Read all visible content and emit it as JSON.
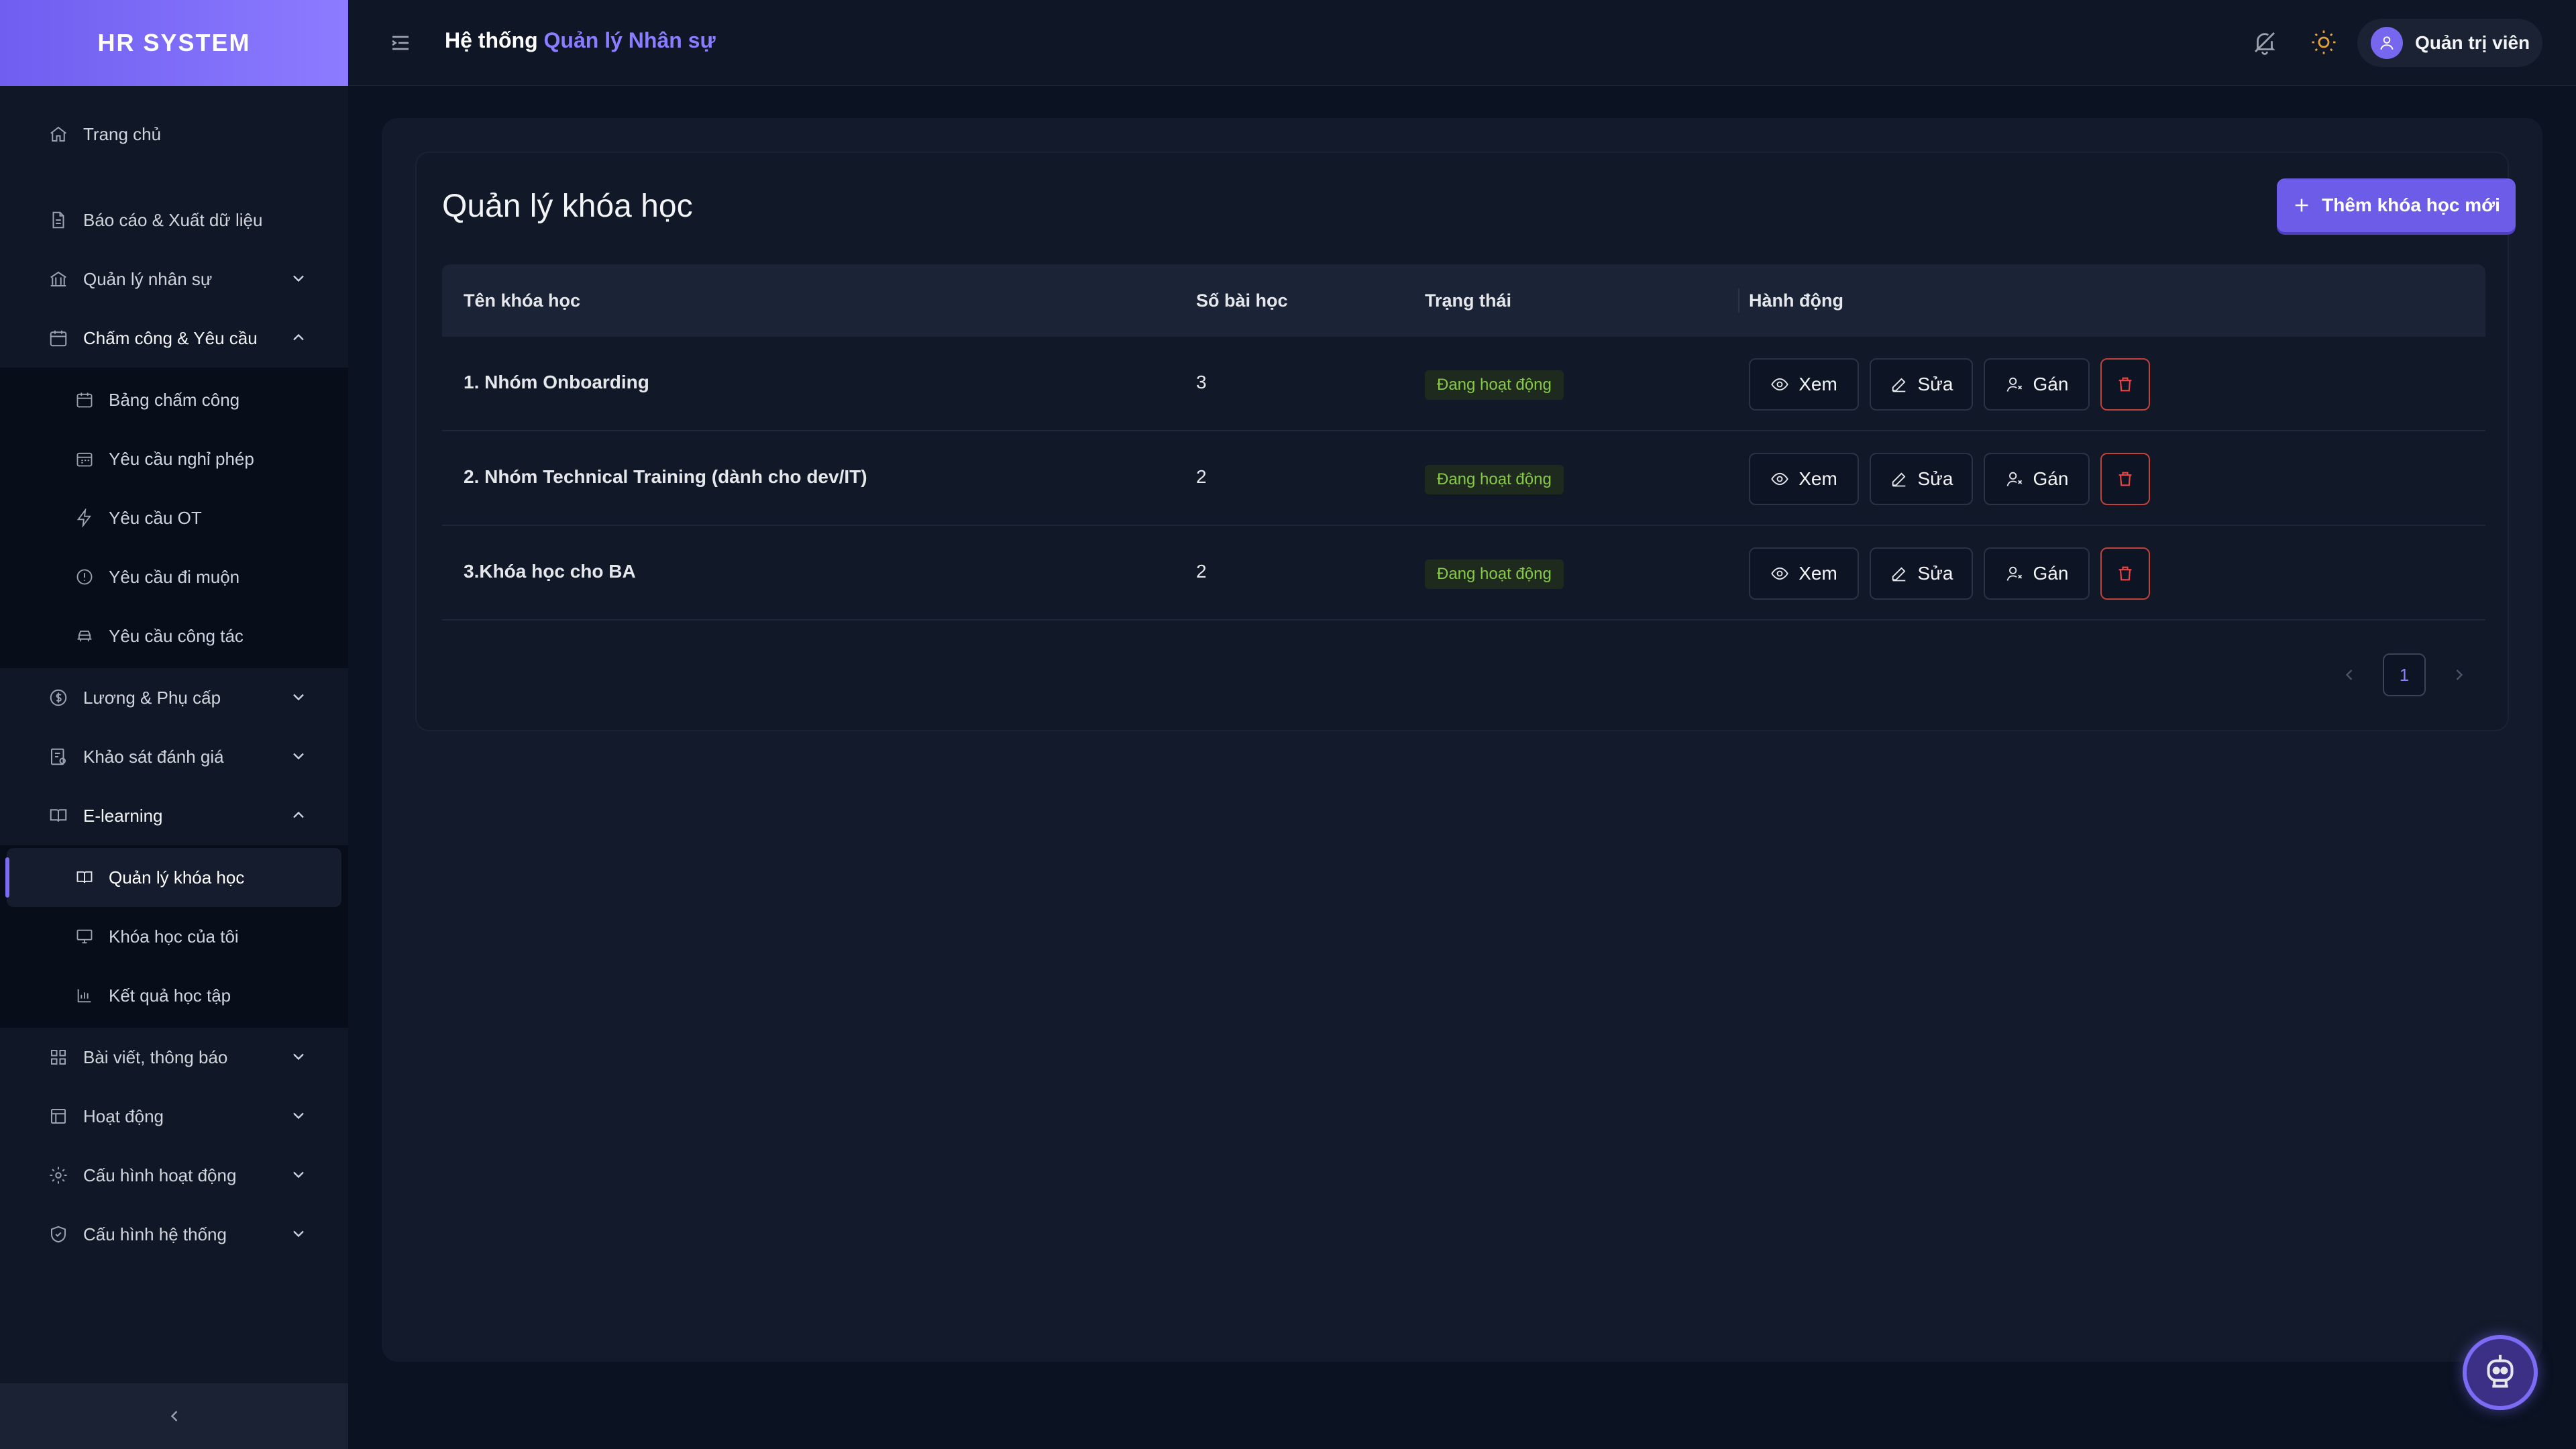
{
  "brand": "HR SYSTEM",
  "header": {
    "title_prefix": "Hệ thống",
    "title_accent": "Quản lý Nhân sự",
    "user_name": "Quản trị viên"
  },
  "sidebar": {
    "items": [
      {
        "label": "Trang chủ",
        "icon": "home-icon"
      },
      {
        "label": "Báo cáo & Xuất dữ liệu",
        "icon": "file-report-icon"
      },
      {
        "label": "Quản lý nhân sự",
        "icon": "building-icon"
      },
      {
        "label": "Chấm công & Yêu cầu",
        "icon": "calendar-icon"
      },
      {
        "label": "Lương & Phụ cấp",
        "icon": "dollar-circle-icon"
      },
      {
        "label": "Khảo sát đánh giá",
        "icon": "survey-icon"
      },
      {
        "label": "E-learning",
        "icon": "book-open-icon"
      },
      {
        "label": "Bài viết, thông báo",
        "icon": "grid-icon"
      },
      {
        "label": "Hoạt động",
        "icon": "activity-icon"
      },
      {
        "label": "Cấu hình hoạt động",
        "icon": "gear-icon"
      },
      {
        "label": "Cấu hình hệ thống",
        "icon": "shield-icon"
      }
    ],
    "attendance_sub": [
      {
        "label": "Bảng chấm công",
        "icon": "calendar-icon"
      },
      {
        "label": "Yêu cầu nghỉ phép",
        "icon": "calendar-leave-icon"
      },
      {
        "label": "Yêu cầu OT",
        "icon": "lightning-icon"
      },
      {
        "label": "Yêu cầu đi muộn",
        "icon": "alert-circle-icon"
      },
      {
        "label": "Yêu cầu công tác",
        "icon": "car-icon"
      }
    ],
    "elearning_sub": [
      {
        "label": "Quản lý khóa học",
        "icon": "book-open-icon"
      },
      {
        "label": "Khóa học của tôi",
        "icon": "monitor-icon"
      },
      {
        "label": "Kết quả học tập",
        "icon": "bar-chart-icon"
      }
    ]
  },
  "page": {
    "title": "Quản lý khóa học",
    "add_button": "Thêm khóa học mới",
    "columns": [
      "Tên khóa học",
      "Số bài học",
      "Trạng thái",
      "Hành động"
    ],
    "rows": [
      {
        "name": "1. Nhóm Onboarding",
        "lessons": "3",
        "status": "Đang hoạt động"
      },
      {
        "name": "2. Nhóm Technical Training (dành cho dev/IT)",
        "lessons": "2",
        "status": "Đang hoạt động"
      },
      {
        "name": "3.Khóa học cho BA",
        "lessons": "2",
        "status": "Đang hoạt động"
      }
    ],
    "actions": {
      "view": "Xem",
      "edit": "Sửa",
      "assign": "Gán"
    },
    "pagination": {
      "current": "1"
    }
  },
  "colors": {
    "accent": "#7c6cf5",
    "status_text": "#86c946",
    "delete": "#ef4444"
  }
}
